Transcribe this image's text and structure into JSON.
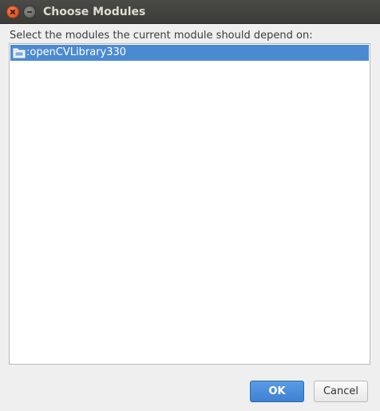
{
  "window": {
    "title": "Choose Modules"
  },
  "dialog": {
    "instruction": "Select the modules the current module should depend on:"
  },
  "modules": [
    {
      "label": ":openCVLibrary330",
      "selected": true,
      "icon": "folder-icon"
    }
  ],
  "buttons": {
    "ok_label": "OK",
    "cancel_label": "Cancel"
  },
  "colors": {
    "selection": "#4b8ad1",
    "primary_button": "#3f82d1",
    "titlebar": "#3b3b38",
    "close_button": "#e35b2d"
  }
}
